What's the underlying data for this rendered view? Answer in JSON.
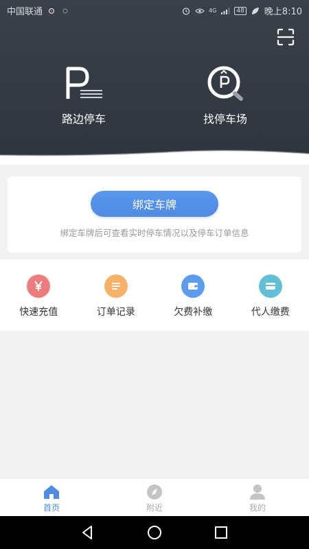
{
  "status_bar": {
    "carrier": "中国联通",
    "network": "4G",
    "battery": "48",
    "time": "晚上8:10"
  },
  "header": {
    "features": [
      {
        "label": "路边停车",
        "icon": "parking-sign-icon"
      },
      {
        "label": "找停车场",
        "icon": "parking-search-icon"
      }
    ],
    "scan_icon": "scan-icon"
  },
  "bind_card": {
    "button_label": "绑定车牌",
    "hint": "绑定车牌后可查看实时停车情况以及停车订单信息"
  },
  "actions": [
    {
      "label": "快速充值",
      "icon": "yen-icon",
      "color": "#ef7c7c"
    },
    {
      "label": "订单记录",
      "icon": "list-icon",
      "color": "#f7b267"
    },
    {
      "label": "欠费补缴",
      "icon": "wallet-icon",
      "color": "#5b9cf0"
    },
    {
      "label": "代人缴费",
      "icon": "card-icon",
      "color": "#5fc0d6"
    }
  ],
  "tabbar": {
    "tabs": [
      {
        "label": "首页",
        "icon": "home-icon",
        "active": true
      },
      {
        "label": "附近",
        "icon": "compass-icon",
        "active": false
      },
      {
        "label": "我的",
        "icon": "user-icon",
        "active": false
      }
    ]
  },
  "colors": {
    "accent": "#4f8ae4",
    "header_bg": "#353b44",
    "page_bg": "#f2f2f2"
  }
}
